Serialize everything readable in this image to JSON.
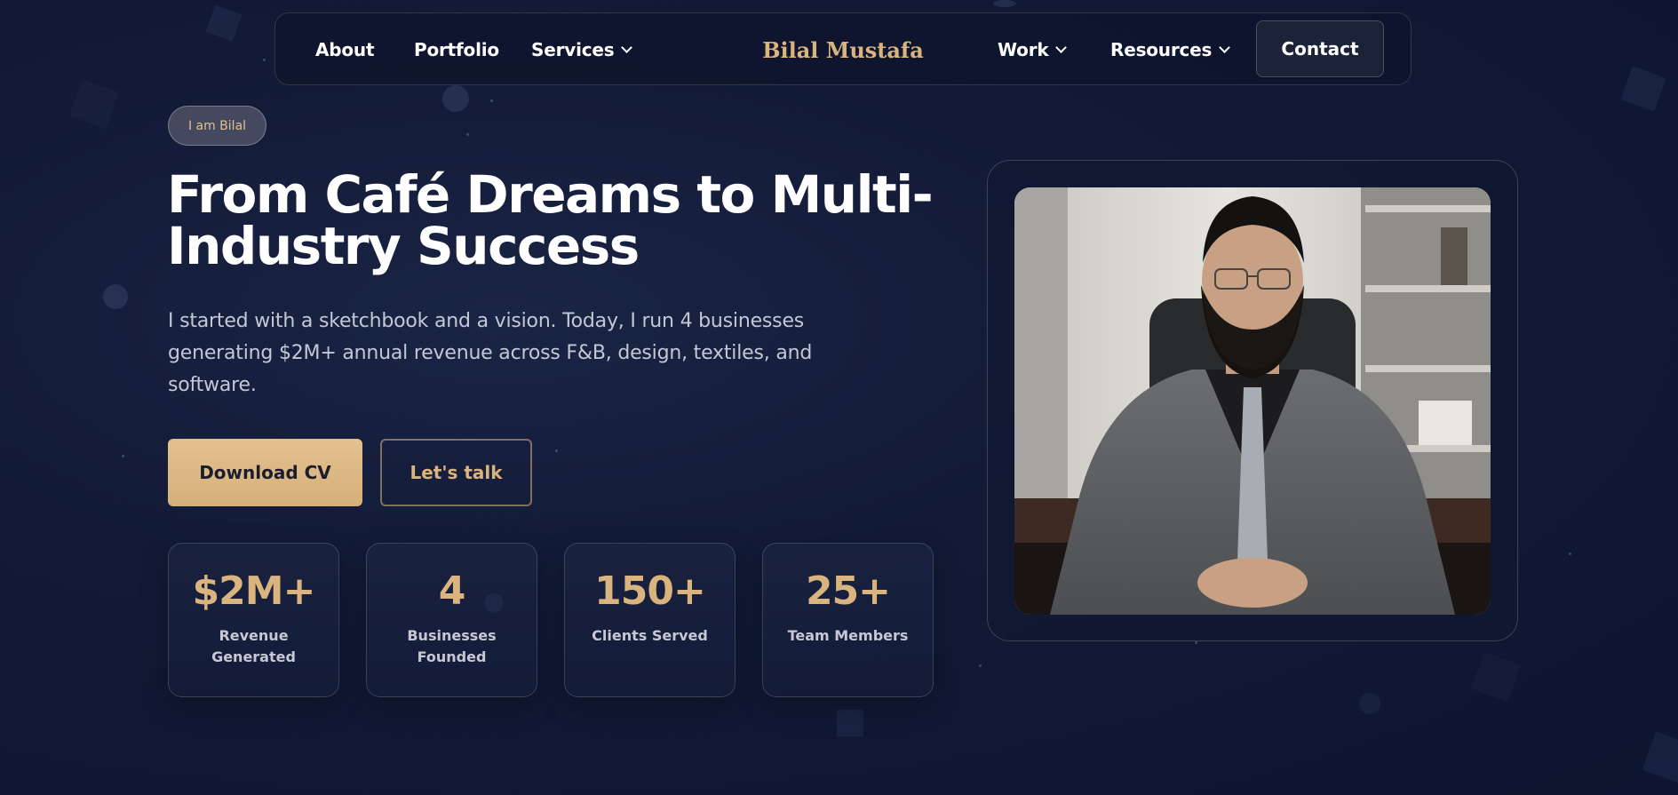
{
  "nav": {
    "about": "About",
    "portfolio": "Portfolio",
    "services": "Services",
    "brand": "Bilal Mustafa",
    "work": "Work",
    "resources": "Resources",
    "contact": "Contact"
  },
  "hero": {
    "badge": "I am Bilal",
    "headline_line1": "From Café Dreams to Multi-",
    "headline_line2": "Industry Success",
    "lead": "I started with a sketchbook and a vision. Today, I run 4 businesses generating $2M+ annual revenue across F&B, design, textiles, and software.",
    "download_cv": "Download CV",
    "lets_talk": "Let's talk"
  },
  "stats": [
    {
      "value": "$2M+",
      "label": "Revenue Generated"
    },
    {
      "value": "4",
      "label": "Businesses Founded"
    },
    {
      "value": "150+",
      "label": "Clients Served"
    },
    {
      "value": "25+",
      "label": "Team Members"
    }
  ],
  "colors": {
    "accent": "#d9b47f",
    "background": "#121a36",
    "primary_button": "#dfba86"
  },
  "icons": {
    "dropdown": "chevron-down-icon"
  }
}
